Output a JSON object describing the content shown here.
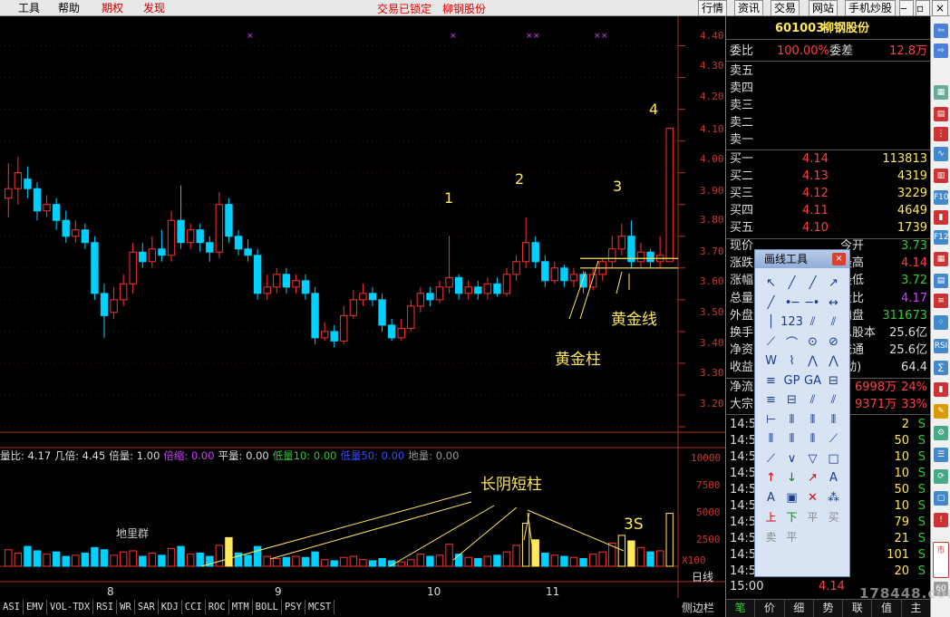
{
  "menus": [
    "工具",
    "帮助",
    "期权",
    "发现"
  ],
  "top_title": [
    "交易已锁定",
    "柳钢股份"
  ],
  "top_buttons": [
    "行情",
    "资讯",
    "交易",
    "网站",
    "手机炒股"
  ],
  "stock": {
    "code": "601003",
    "name": "柳钢股份"
  },
  "panel": {
    "weibi_label": "委比",
    "weibi_value": "100.00%",
    "weicha_label": "委差",
    "weicha_value": "12.8万",
    "sell": [
      {
        "label": "卖五"
      },
      {
        "label": "卖四"
      },
      {
        "label": "卖三"
      },
      {
        "label": "卖二"
      },
      {
        "label": "卖一"
      }
    ],
    "buy": [
      {
        "label": "买一",
        "price": "4.14",
        "vol": "113813"
      },
      {
        "label": "买二",
        "price": "4.13",
        "vol": "4319"
      },
      {
        "label": "买三",
        "price": "4.12",
        "vol": "3229"
      },
      {
        "label": "买四",
        "price": "4.11",
        "vol": "4649"
      },
      {
        "label": "买五",
        "price": "4.10",
        "vol": "1739"
      }
    ],
    "stats": [
      {
        "l": "现价",
        "v": "3.73",
        "c": "#3c3"
      },
      {
        "l": "涨跌",
        "v": "4.14",
        "c": "#ff4040"
      },
      {
        "l": "涨幅",
        "v": "3.72",
        "c": "#3c3"
      },
      {
        "l": "总量",
        "v": "4.17",
        "c": "#d040ff"
      },
      {
        "l": "外盘",
        "v": "311673",
        "c": "#3c3"
      },
      {
        "l": "换手",
        "v": "25.6亿",
        "c": "#ddd"
      },
      {
        "l": "净资",
        "v": "25.6亿",
        "c": "#ddd"
      },
      {
        "l": "收益",
        "v": "64.4",
        "c": "#ddd"
      }
    ],
    "stats_right_labels": [
      "今开",
      "最高",
      "最低",
      "量比",
      "内盘",
      "总股本",
      "流通",
      "(动)"
    ],
    "flow": [
      {
        "l": "净流",
        "a": "6998万",
        "p": "24%"
      },
      {
        "l": "大宗",
        "a": "9371万",
        "p": "33%"
      }
    ],
    "ticks": [
      {
        "t": "14:5",
        "v": "2",
        "s": "S"
      },
      {
        "t": "14:5",
        "v": "50",
        "s": "S"
      },
      {
        "t": "14:5",
        "v": "10",
        "s": "S"
      },
      {
        "t": "14:5",
        "v": "10",
        "s": "S"
      },
      {
        "t": "14:5",
        "v": "50",
        "s": "S"
      },
      {
        "t": "14:5",
        "v": "10",
        "s": "S"
      },
      {
        "t": "14:5",
        "v": "79",
        "s": "S"
      },
      {
        "t": "14:5",
        "v": "21",
        "s": "S"
      },
      {
        "t": "14:5",
        "v": "101",
        "s": "S"
      },
      {
        "t": "14:5",
        "v": "20",
        "s": "S"
      }
    ],
    "last_tick": {
      "t": "15:00",
      "p": "4.14"
    },
    "bottom_tabs": [
      "笔",
      "价",
      "细",
      "势",
      "联",
      "值",
      "主"
    ]
  },
  "price_axis": [
    "4.40",
    "4.30",
    "4.20",
    "4.10",
    "4.00",
    "3.90",
    "3.80",
    "3.70",
    "3.60",
    "3.50",
    "3.40",
    "3.30",
    "3.20"
  ],
  "volume_axis": [
    "10000",
    "7500",
    "5000",
    "2500"
  ],
  "volume_unit": "X100",
  "indicator_bar": [
    {
      "t": "量比: 4.17",
      "c": "#ddd"
    },
    {
      "t": "几倍: 4.45",
      "c": "#ddd"
    },
    {
      "t": "倍量: 1.00",
      "c": "#ddd"
    },
    {
      "t": "倍缩: 0.00",
      "c": "#d040ff"
    },
    {
      "t": "平量: 0.00",
      "c": "#ddd"
    },
    {
      "t": "低量10: 0.00",
      "c": "#3c3"
    },
    {
      "t": "低量50: 0.00",
      "c": "#3050ff"
    },
    {
      "t": "地量: 0.00",
      "c": "#999"
    }
  ],
  "dates": [
    "8",
    "9",
    "10",
    "11"
  ],
  "period_label": "日线",
  "annotations": {
    "golden_line": "黄金线",
    "golden_bar": "黄金柱",
    "long_yin": "长阴短柱",
    "three_s": "3S",
    "ground_group": "地里群",
    "markers": [
      "1",
      "2",
      "3",
      "4"
    ]
  },
  "bottom_tabs": [
    "ASI",
    "EMV",
    "VOL-TDX",
    "RSI",
    "WR",
    "SAR",
    "KDJ",
    "CCI",
    "ROC",
    "MTM",
    "BOLL",
    "PSY",
    "MCST"
  ],
  "sidebar_label": "侧边栏",
  "drawtool": {
    "title": "画线工具",
    "close": "×",
    "row_labels": [
      "上",
      "下",
      "平",
      "买",
      "卖",
      "平"
    ]
  },
  "watermark": "178448.com",
  "chart_data": {
    "type": "candlestick",
    "ylim": [
      3.18,
      4.43
    ],
    "candles": [
      [
        3.92,
        3.95,
        3.86,
        4.03
      ],
      [
        3.95,
        4.0,
        3.9,
        4.05
      ],
      [
        3.98,
        3.95,
        3.92,
        4.02
      ],
      [
        3.95,
        3.88,
        3.85,
        3.97
      ],
      [
        3.88,
        3.9,
        3.86,
        3.93
      ],
      [
        3.9,
        3.85,
        3.82,
        3.92
      ],
      [
        3.85,
        3.8,
        3.78,
        3.88
      ],
      [
        3.8,
        3.82,
        3.78,
        3.85
      ],
      [
        3.82,
        3.78,
        3.76,
        3.84
      ],
      [
        3.78,
        3.62,
        3.6,
        3.8
      ],
      [
        3.62,
        3.55,
        3.48,
        3.65
      ],
      [
        3.56,
        3.6,
        3.54,
        3.64
      ],
      [
        3.6,
        3.65,
        3.58,
        3.68
      ],
      [
        3.65,
        3.75,
        3.62,
        3.78
      ],
      [
        3.75,
        3.72,
        3.7,
        3.78
      ],
      [
        3.72,
        3.76,
        3.7,
        3.8
      ],
      [
        3.76,
        3.74,
        3.72,
        3.82
      ],
      [
        3.74,
        3.85,
        3.72,
        3.88
      ],
      [
        3.85,
        3.78,
        3.76,
        3.96
      ],
      [
        3.78,
        3.82,
        3.76,
        3.84
      ],
      [
        3.82,
        3.78,
        3.75,
        3.84
      ],
      [
        3.78,
        3.75,
        3.72,
        3.8
      ],
      [
        3.75,
        3.9,
        3.73,
        3.94
      ],
      [
        3.9,
        3.8,
        3.78,
        3.92
      ],
      [
        3.8,
        3.76,
        3.74,
        3.82
      ],
      [
        3.76,
        3.74,
        3.72,
        3.79
      ],
      [
        3.74,
        3.62,
        3.6,
        3.76
      ],
      [
        3.62,
        3.64,
        3.6,
        3.68
      ],
      [
        3.64,
        3.68,
        3.62,
        3.7
      ],
      [
        3.68,
        3.64,
        3.62,
        3.7
      ],
      [
        3.64,
        3.66,
        3.62,
        3.68
      ],
      [
        3.66,
        3.62,
        3.6,
        3.68
      ],
      [
        3.62,
        3.48,
        3.46,
        3.64
      ],
      [
        3.48,
        3.5,
        3.47,
        3.53
      ],
      [
        3.5,
        3.47,
        3.45,
        3.52
      ],
      [
        3.47,
        3.55,
        3.46,
        3.58
      ],
      [
        3.55,
        3.6,
        3.54,
        3.63
      ],
      [
        3.6,
        3.62,
        3.58,
        3.65
      ],
      [
        3.62,
        3.6,
        3.58,
        3.64
      ],
      [
        3.6,
        3.52,
        3.5,
        3.62
      ],
      [
        3.52,
        3.48,
        3.47,
        3.54
      ],
      [
        3.48,
        3.51,
        3.47,
        3.54
      ],
      [
        3.51,
        3.58,
        3.5,
        3.6
      ],
      [
        3.58,
        3.62,
        3.56,
        3.64
      ],
      [
        3.62,
        3.6,
        3.58,
        3.64
      ],
      [
        3.6,
        3.64,
        3.59,
        3.66
      ],
      [
        3.64,
        3.67,
        3.62,
        3.8
      ],
      [
        3.67,
        3.62,
        3.6,
        3.68
      ],
      [
        3.62,
        3.64,
        3.6,
        3.66
      ],
      [
        3.64,
        3.62,
        3.6,
        3.66
      ],
      [
        3.62,
        3.65,
        3.6,
        3.67
      ],
      [
        3.65,
        3.62,
        3.61,
        3.67
      ],
      [
        3.62,
        3.68,
        3.61,
        3.7
      ],
      [
        3.68,
        3.72,
        3.66,
        3.74
      ],
      [
        3.72,
        3.78,
        3.7,
        3.86
      ],
      [
        3.78,
        3.72,
        3.7,
        3.8
      ],
      [
        3.72,
        3.66,
        3.64,
        3.74
      ],
      [
        3.66,
        3.7,
        3.65,
        3.72
      ],
      [
        3.7,
        3.66,
        3.64,
        3.71
      ],
      [
        3.66,
        3.68,
        3.64,
        3.7
      ],
      [
        3.68,
        3.64,
        3.62,
        3.69
      ],
      [
        3.64,
        3.68,
        3.63,
        3.7
      ],
      [
        3.68,
        3.72,
        3.66,
        3.73
      ],
      [
        3.72,
        3.76,
        3.7,
        3.8
      ],
      [
        3.76,
        3.8,
        3.74,
        3.84
      ],
      [
        3.8,
        3.72,
        3.7,
        3.85
      ],
      [
        3.72,
        3.75,
        3.7,
        3.78
      ],
      [
        3.75,
        3.72,
        3.7,
        3.76
      ],
      [
        3.72,
        3.74,
        3.7,
        3.8
      ],
      [
        3.72,
        4.14,
        3.72,
        4.14
      ]
    ],
    "volumes": [
      1500,
      1200,
      1800,
      1400,
      1100,
      1300,
      900,
      1000,
      1200,
      1700,
      1500,
      1000,
      1300,
      1400,
      900,
      1200,
      1000,
      1600,
      1800,
      1100,
      1200,
      900,
      1900,
      2600,
      1200,
      1000,
      1800,
      900,
      700,
      800,
      900,
      800,
      1300,
      600,
      500,
      800,
      900,
      600,
      500,
      700,
      500,
      400,
      600,
      1100,
      900,
      1000,
      2000,
      1100,
      800,
      700,
      900,
      1000,
      1300,
      1900,
      3900,
      2400,
      1200,
      1000,
      900,
      800,
      700,
      1100,
      1300,
      2100,
      2800,
      2300,
      1700,
      1300,
      1400,
      4800
    ],
    "golden_line_price": [
      3.73,
      3.7
    ],
    "markers_index": [
      46,
      54,
      64,
      69
    ]
  }
}
